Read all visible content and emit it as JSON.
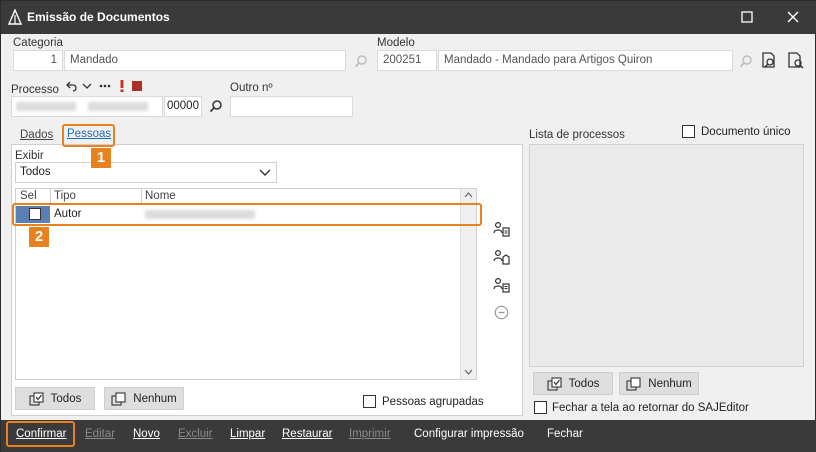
{
  "window": {
    "title": "Emissão de Documentos"
  },
  "categoria": {
    "label": "Categoria",
    "code": "1",
    "name": "Mandado"
  },
  "modelo": {
    "label": "Modelo",
    "code": "200251",
    "name": "Mandado - Mandado para Artigos Quiron"
  },
  "processo": {
    "label": "Processo",
    "suffix": "00000"
  },
  "outro": {
    "label": "Outro nº",
    "value": ""
  },
  "tabs": [
    {
      "label": "Dados"
    },
    {
      "label": "Pessoas"
    }
  ],
  "exibir": {
    "label": "Exibir",
    "value": "Todos"
  },
  "grid": {
    "columns": [
      "Sel",
      "Tipo",
      "Nome"
    ],
    "rows": [
      {
        "tipo": "Autor"
      }
    ]
  },
  "buttons": {
    "todos": "Todos",
    "nenhum": "Nenhum",
    "pessoas_agrupadas": "Pessoas agrupadas"
  },
  "right": {
    "lista_label": "Lista de processos",
    "doc_unico": "Documento único",
    "todos": "Todos",
    "nenhum": "Nenhum",
    "fechar_tela": "Fechar a tela ao retornar do SAJEditor"
  },
  "toolbar": {
    "confirmar": "Confirmar",
    "editar": "Editar",
    "novo": "Novo",
    "excluir": "Excluir",
    "limpar": "Limpar",
    "restaurar": "Restaurar",
    "imprimir": "Imprimir",
    "configurar": "Configurar impressão",
    "fechar": "Fechar"
  },
  "annotations": [
    "1",
    "2"
  ],
  "colors": {
    "highlight": "#e8821e",
    "titlebar": "#3a3a3a",
    "link": "#1a6fb8"
  }
}
